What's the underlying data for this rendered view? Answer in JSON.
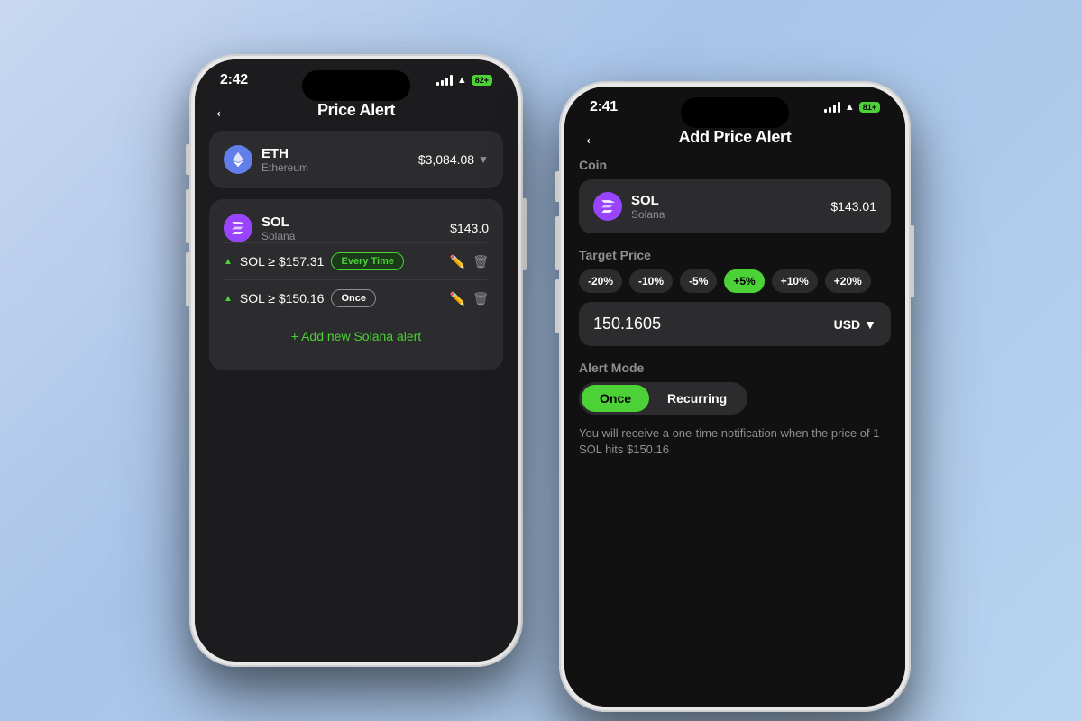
{
  "background": "#b8d0ea",
  "phone1": {
    "time": "2:42",
    "battery": "82+",
    "title": "Price Alert",
    "eth": {
      "symbol": "ETH",
      "name": "Ethereum",
      "price": "$3,084.08",
      "icon": "Ξ"
    },
    "sol": {
      "symbol": "SOL",
      "name": "Solana",
      "price": "$143.0",
      "icon": "◎",
      "alerts": [
        {
          "condition": "SOL ≥ $157.31",
          "badge": "Every Time",
          "badgeType": "green"
        },
        {
          "condition": "SOL ≥ $150.16",
          "badge": "Once",
          "badgeType": "outline"
        }
      ]
    },
    "addAlertLabel": "+ Add new Solana alert"
  },
  "phone2": {
    "time": "2:41",
    "battery": "81+",
    "title": "Add Price Alert",
    "coinLabel": "Coin",
    "coin": {
      "symbol": "SOL",
      "name": "Solana",
      "price": "$143.01",
      "icon": "◎"
    },
    "targetPriceLabel": "Target Price",
    "priceChips": [
      "-20%",
      "-10%",
      "-5%",
      "+5%",
      "+10%",
      "+20%"
    ],
    "activeChip": "+5%",
    "priceValue": "150.1605",
    "currency": "USD",
    "alertModeLabel": "Alert Mode",
    "modes": [
      "Once",
      "Recurring"
    ],
    "activeMode": "Once",
    "notificationText": "You will receive a one-time notification when the price of 1 SOL hits $150.16"
  }
}
